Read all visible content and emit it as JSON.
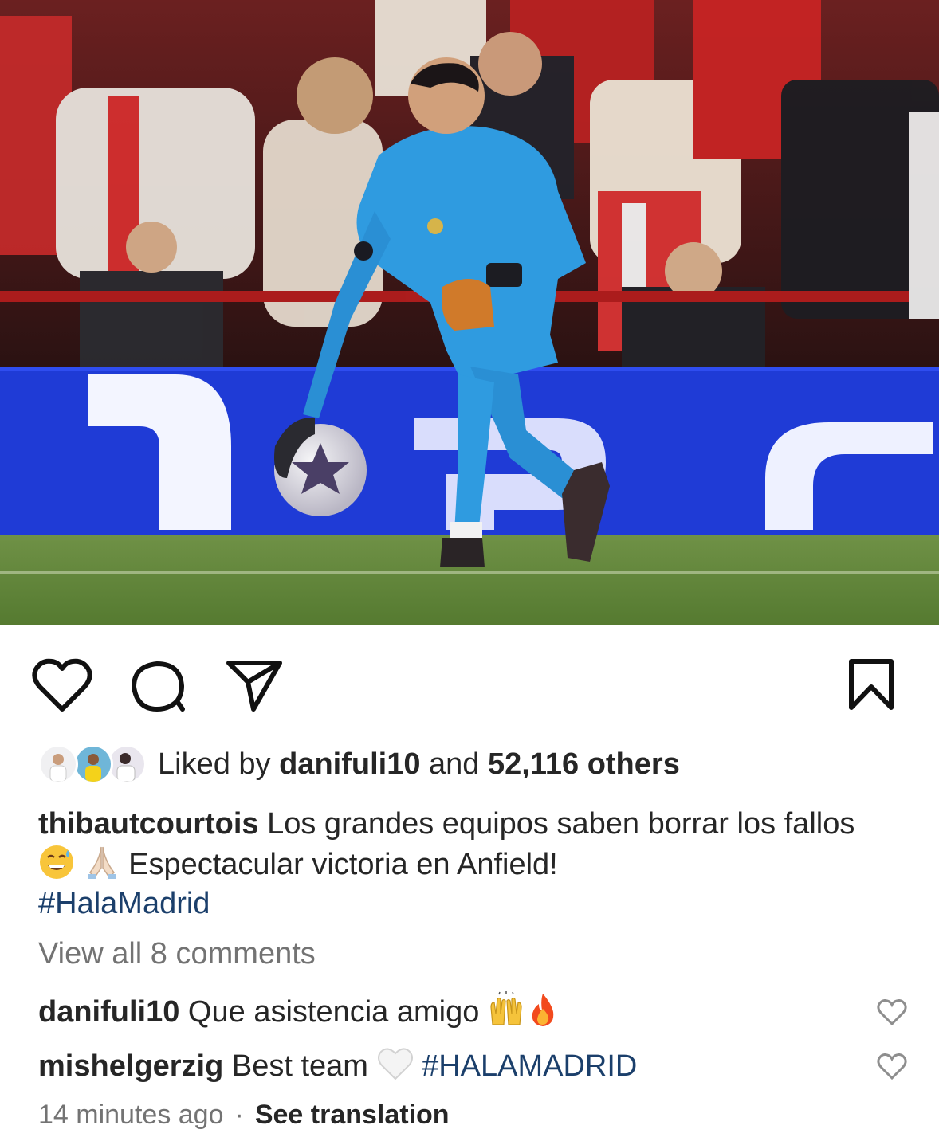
{
  "post": {
    "photo_alt": "goalkeeper photo",
    "banner_colors": {
      "crowd": "#5a2222",
      "board": "#1f3bd6",
      "pitch": "#4f7a2e",
      "kit": "#2f9be0"
    }
  },
  "actions": {
    "like_icon": "heart-icon",
    "comment_icon": "comment-icon",
    "share_icon": "paper-plane-icon",
    "save_icon": "bookmark-icon"
  },
  "likes": {
    "prefix": "Liked by ",
    "user": "danifuli10",
    "middle": " and ",
    "others": "52,116 others"
  },
  "caption": {
    "username": "thibautcourtois",
    "text_1": " Los grandes equipos saben borrar los fallos ",
    "emoji_1": "grinning-sweat-emoji",
    "emoji_2": "folded-hands-emoji",
    "text_2": " Espectacular victoria en Anfield!",
    "hashtag": "#HalaMadrid"
  },
  "view_all": "View all 8 comments",
  "comments": [
    {
      "username": "danifuli10",
      "text": " Que asistencia amigo ",
      "emojis": [
        "raised-hands-emoji",
        "fire-emoji"
      ]
    },
    {
      "username": "mishelgerzig",
      "text": " Best team ",
      "emojis": [
        "white-heart-emoji"
      ],
      "hashtag": "#HALAMADRID"
    }
  ],
  "meta": {
    "time": "14 minutes ago",
    "separator": "·",
    "translation": "See translation"
  },
  "colors": {
    "hashtag": "#1b3f6b",
    "muted": "#737373",
    "text": "#262626"
  }
}
